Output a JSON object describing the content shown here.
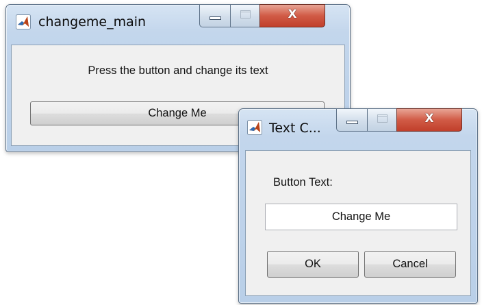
{
  "main_window": {
    "title": "changeme_main",
    "prompt": "Press the button and change its text",
    "button_label": "Change Me"
  },
  "dialog": {
    "title": "Text C...",
    "field_label": "Button Text:",
    "field_value": "Change Me",
    "ok_label": "OK",
    "cancel_label": "Cancel"
  },
  "icons": {
    "app": "matlab-logo-icon",
    "minimize": "minimize-icon",
    "maximize": "maximize-icon",
    "close": "close-icon"
  },
  "colors": {
    "frame": "#c3d6ec",
    "close_button": "#c94b36",
    "client": "#f0f0f0"
  }
}
